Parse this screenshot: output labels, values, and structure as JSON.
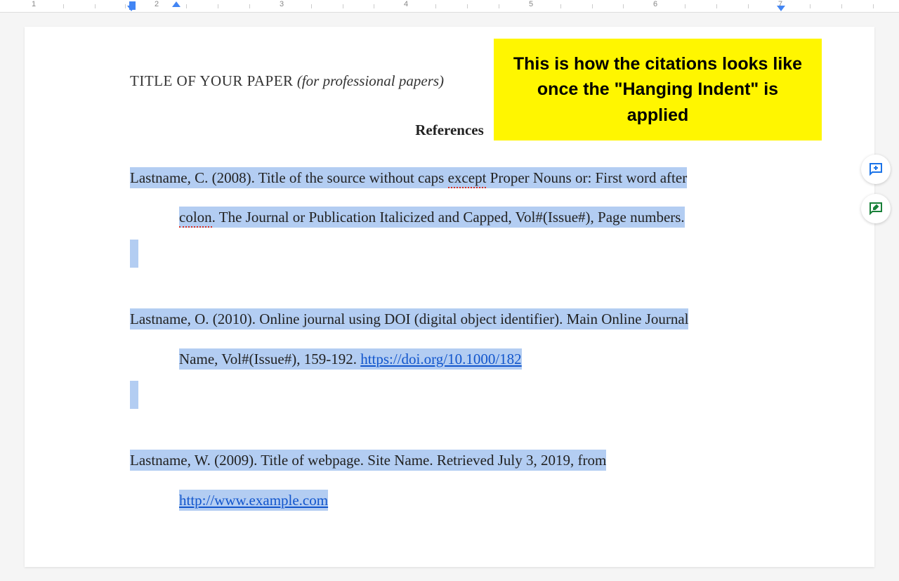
{
  "ruler": {
    "majors": [
      "1",
      "2",
      "3",
      "4",
      "5",
      "6",
      "7"
    ]
  },
  "document": {
    "title": "TITLE OF YOUR PAPER",
    "titleSuffix": "(for professional papers)",
    "referencesHeading": "References"
  },
  "callout": {
    "text": "This is how the citations looks like once the \"Hanging Indent\" is applied"
  },
  "citations": [
    {
      "line1_pre": "Lastname, C. (2008). Title of the source without caps ",
      "line1_err": "except",
      "line1_post": " Proper Nouns or: First word after",
      "line2_pre": "",
      "line2_err": "colon",
      "line2_post": ". The Journal or Publication Italicized and Capped, Vol#(Issue#), Page numbers.",
      "hasLink": false
    },
    {
      "line1_pre": "Lastname, O. (2010). Online journal using DOI (digital object identifier). Main Online Journal",
      "line1_err": "",
      "line1_post": "",
      "line2_pre": "Name, Vol#(Issue#), 159-192. ",
      "line2_err": "",
      "line2_post": "",
      "linkText": "https://doi.org/10.1000/182",
      "hasLink": true
    },
    {
      "line1_pre": "Lastname, W. (2009). Title of webpage. Site Name. Retrieved July 3, 2019, from",
      "line1_err": "",
      "line1_post": "",
      "line2_pre": "",
      "line2_err": "",
      "line2_post": "",
      "linkText": "http://www.example.com",
      "hasLink": true
    }
  ]
}
